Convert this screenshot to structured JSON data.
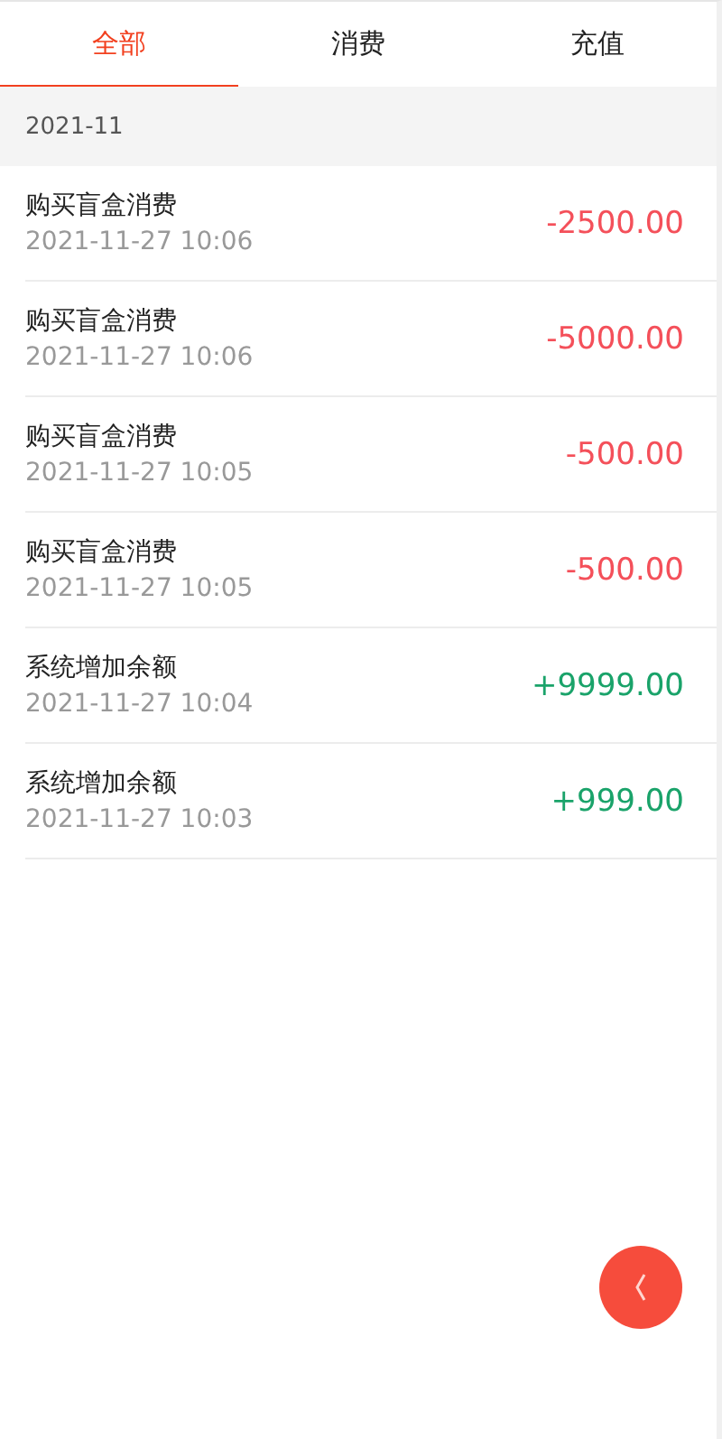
{
  "tabs": [
    {
      "label": "全部",
      "selected": true
    },
    {
      "label": "消费",
      "selected": false
    },
    {
      "label": "充值",
      "selected": false
    }
  ],
  "month": "2021-11",
  "records": [
    {
      "title": "购买盲盒消费",
      "time": "2021-11-27 10:06",
      "amount": "-2500.00",
      "kind": "expense"
    },
    {
      "title": "购买盲盒消费",
      "time": "2021-11-27 10:06",
      "amount": "-5000.00",
      "kind": "expense"
    },
    {
      "title": "购买盲盒消费",
      "time": "2021-11-27 10:05",
      "amount": "-500.00",
      "kind": "expense"
    },
    {
      "title": "购买盲盒消费",
      "time": "2021-11-27 10:05",
      "amount": "-500.00",
      "kind": "expense"
    },
    {
      "title": "系统增加余额",
      "time": "2021-11-27 10:04",
      "amount": "+9999.00",
      "kind": "income"
    },
    {
      "title": "系统增加余额",
      "time": "2021-11-27 10:03",
      "amount": "+999.00",
      "kind": "income"
    }
  ]
}
